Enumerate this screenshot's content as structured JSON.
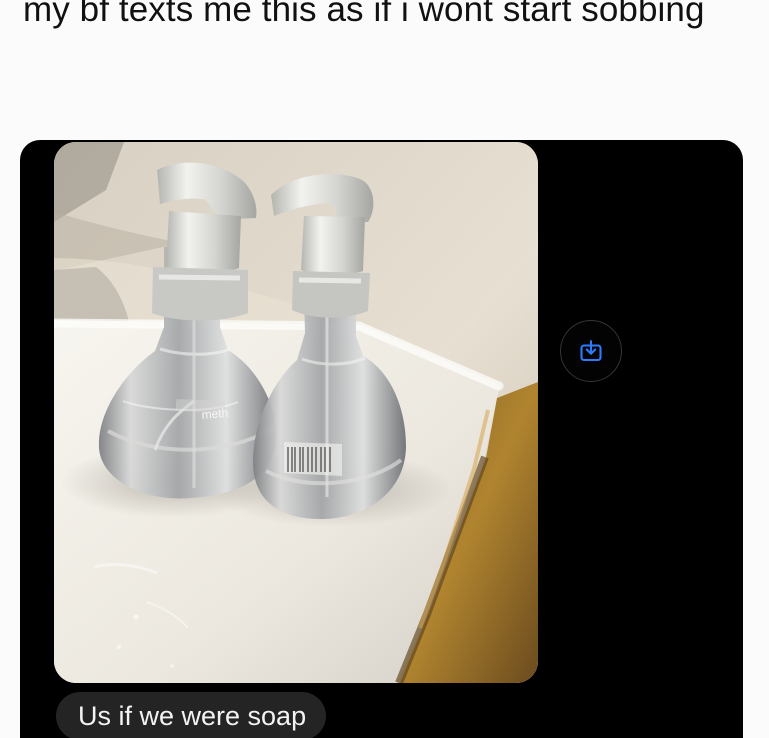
{
  "post": {
    "caption": "my bf texts me this as if i wont start sobbing"
  },
  "chat": {
    "message_text": "Us if we were soap",
    "save_icon": "download-icon",
    "accent": "#2d7cff"
  },
  "photo": {
    "bottle_label_text": "meth"
  },
  "colors": {
    "page_background": "#fbfbfb",
    "chat_background": "#000000",
    "message_bubble": "#242424",
    "caption_text": "#111111"
  }
}
